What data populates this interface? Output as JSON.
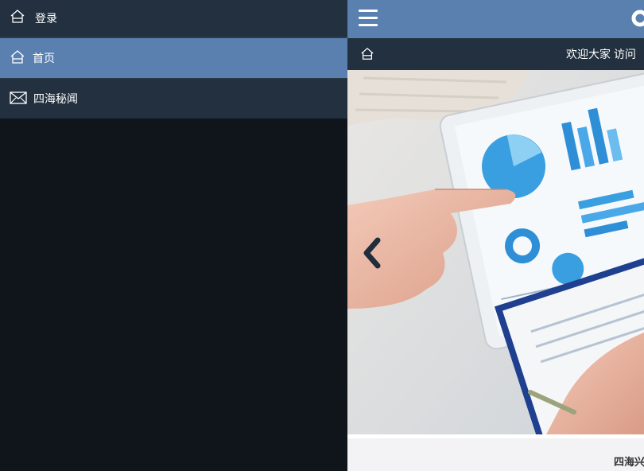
{
  "drawer": {
    "items": [
      {
        "label": "登录",
        "icon": "home-icon"
      },
      {
        "label": "首页",
        "icon": "home-icon",
        "active": true
      },
      {
        "label": "四海秘闻",
        "icon": "envelope-icon"
      }
    ]
  },
  "header": {
    "menu_icon": "hamburger-menu-icon",
    "search_icon": "search-icon"
  },
  "subbar": {
    "home_icon": "home-icon",
    "welcome_text": "欢迎大家  访问"
  },
  "carousel": {
    "prev_icon": "chevron-left-icon",
    "image": "hands pointing at tablet with charts"
  },
  "footer": {
    "text": "四海兴"
  },
  "colors": {
    "accent": "#5a80b0",
    "dark_bar": "#22303f",
    "drawer_bg": "#10151c"
  }
}
